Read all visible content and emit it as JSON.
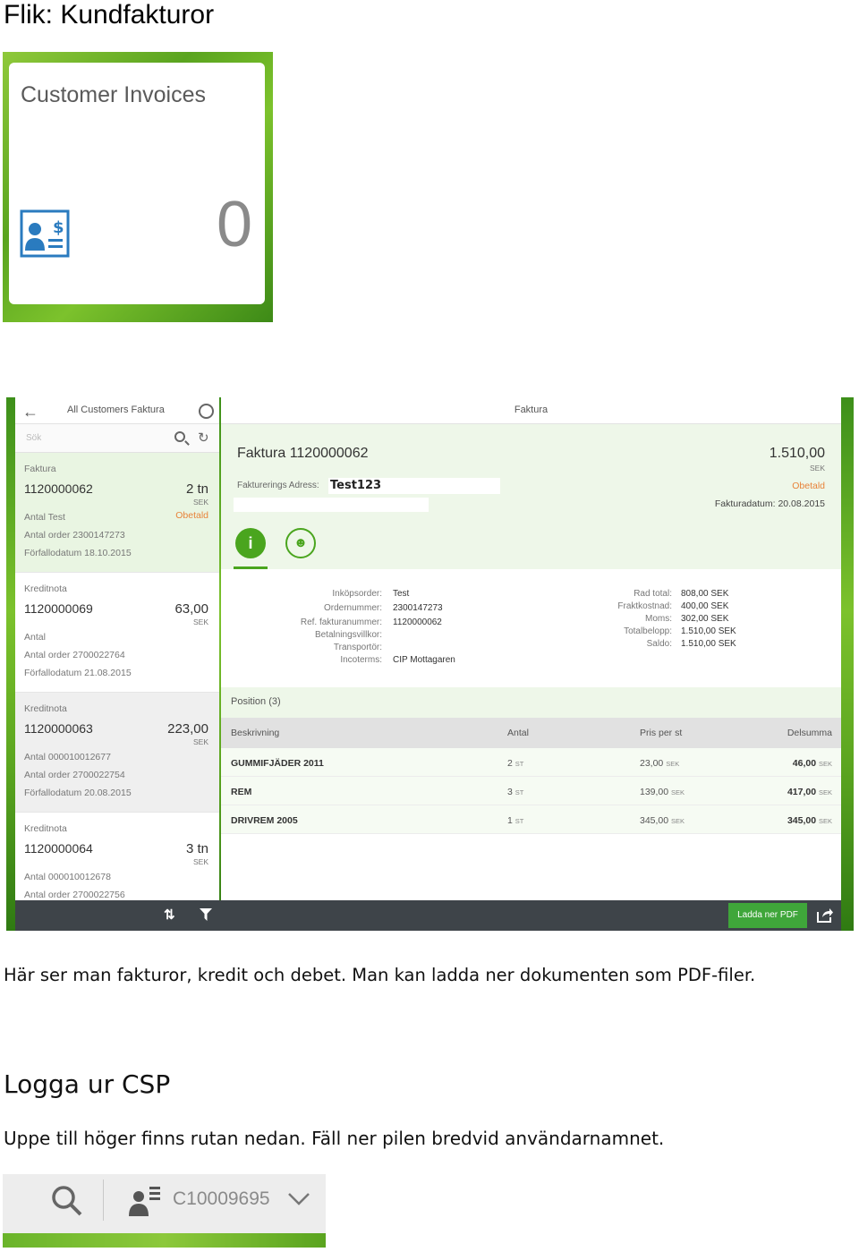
{
  "heading_tab": "Flik: Kundfakturor",
  "tile": {
    "title": "Customer Invoices",
    "count": "0",
    "icon": "invoice-dollar-icon"
  },
  "app": {
    "sidebar_title": "All Customers Faktura",
    "search_placeholder": "Sök",
    "main_title": "Faktura",
    "items": [
      {
        "type": "Faktura",
        "number": "1120000062",
        "amount": "2 tn",
        "currency": "SEK",
        "status": "Obetald",
        "line1": "Antal Test",
        "line2": "Antal order 2300147273",
        "line3": "Förfallodatum 18.10.2015"
      },
      {
        "type": "Kreditnota",
        "number": "1120000069",
        "amount": "63,00",
        "currency": "SEK",
        "status": "",
        "line1": "Antal",
        "line2": "Antal order 2700022764",
        "line3": "Förfallodatum 21.08.2015"
      },
      {
        "type": "Kreditnota",
        "number": "1120000063",
        "amount": "223,00",
        "currency": "SEK",
        "status": "",
        "line1": "Antal 000010012677",
        "line2": "Antal order 2700022754",
        "line3": "Förfallodatum 20.08.2015"
      },
      {
        "type": "Kreditnota",
        "number": "1120000064",
        "amount": "3 tn",
        "currency": "SEK",
        "status": "",
        "line1": "Antal 000010012678",
        "line2": "Antal order 2700022756",
        "line3": ""
      }
    ],
    "invoice": {
      "title": "Faktura 1120000062",
      "total": "1.510,00",
      "currency": "SEK",
      "status": "Obetald",
      "date": "Fakturadatum: 20.08.2015",
      "address_label": "Fakturerings Adress:",
      "address_value": "Test123",
      "details_left": [
        {
          "label": "Inköpsorder:",
          "value": "Test"
        },
        {
          "label": "Ordernummer:",
          "value": "2300147273"
        },
        {
          "label": "Ref. fakturanummer:",
          "value": "1120000062"
        },
        {
          "label": "Betalningsvillkor:",
          "value": ""
        },
        {
          "label": "Transportör:",
          "value": ""
        },
        {
          "label": "Incoterms:",
          "value": "CIP Mottagaren"
        }
      ],
      "details_right": [
        {
          "label": "Rad total:",
          "value": "808,00 SEK"
        },
        {
          "label": "Fraktkostnad:",
          "value": "400,00 SEK"
        },
        {
          "label": "Moms:",
          "value": "302,00 SEK"
        },
        {
          "label": "Totalbelopp:",
          "value": "1.510,00 SEK"
        },
        {
          "label": "Saldo:",
          "value": "1.510,00 SEK"
        }
      ],
      "position_header": "Position (3)",
      "columns": {
        "desc": "Beskrivning",
        "qty": "Antal",
        "price": "Pris per st",
        "sum": "Delsumma"
      },
      "rows": [
        {
          "desc": "GUMMIFJÄDER 2011",
          "qty": "2",
          "qty_unit": "ST",
          "price": "23,00",
          "price_unit": "SEK",
          "sum": "46,00",
          "sum_unit": "SEK"
        },
        {
          "desc": "REM",
          "qty": "3",
          "qty_unit": "ST",
          "price": "139,00",
          "price_unit": "SEK",
          "sum": "417,00",
          "sum_unit": "SEK"
        },
        {
          "desc": "DRIVREM 2005",
          "qty": "1",
          "qty_unit": "ST",
          "price": "345,00",
          "price_unit": "SEK",
          "sum": "345,00",
          "sum_unit": "SEK"
        }
      ]
    },
    "pdf_button": "Ladda ner PDF"
  },
  "paragraph1": "Här ser man fakturor, kredit och debet. Man kan ladda ner dokumenten som PDF-filer.",
  "heading_logout": "Logga ur CSP",
  "paragraph2": "Uppe till höger finns rutan nedan. Fäll ner pilen bredvid användarnamnet.",
  "userbar": {
    "username": "C10009695"
  },
  "colors": {
    "accent_green": "#4aa51e",
    "status_orange": "#e8833a",
    "bar_dark": "#3e4449"
  }
}
